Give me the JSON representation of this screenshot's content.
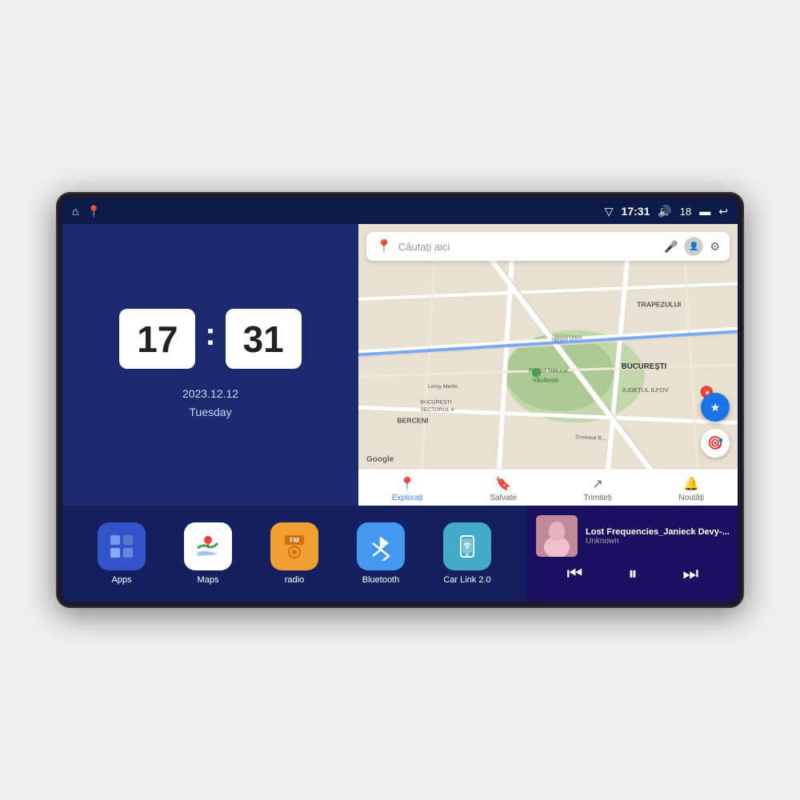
{
  "device": {
    "status_bar": {
      "left_icons": [
        "home-icon",
        "maps-icon"
      ],
      "time": "17:31",
      "volume_icon": "volume-icon",
      "volume_level": "18",
      "battery_icon": "battery-icon",
      "back_icon": "back-icon"
    }
  },
  "left_panel": {
    "clock_hour": "17",
    "clock_minute": "31",
    "date": "2023.12.12",
    "day": "Tuesday"
  },
  "map_panel": {
    "search_placeholder": "Căutați aici",
    "nav_items": [
      {
        "label": "Explorați",
        "icon": "📍",
        "active": true
      },
      {
        "label": "Salvate",
        "icon": "🔖",
        "active": false
      },
      {
        "label": "Trimiteți",
        "icon": "↗",
        "active": false
      },
      {
        "label": "Noutăți",
        "icon": "🔔",
        "active": false
      }
    ],
    "map_labels": [
      "TRAPEZULUI",
      "BUCUREȘTI",
      "JUDEȚUL ILFOV",
      "BERCENI",
      "Parcul Natural Văcărești",
      "Leroy Merlin",
      "BUCUREȘTI\nSECTORUL 4"
    ]
  },
  "apps": [
    {
      "label": "Apps",
      "icon_type": "apps",
      "emoji": "⊞"
    },
    {
      "label": "Maps",
      "icon_type": "maps",
      "emoji": "📍"
    },
    {
      "label": "radio",
      "icon_type": "radio",
      "emoji": "📻"
    },
    {
      "label": "Bluetooth",
      "icon_type": "bluetooth",
      "emoji": "⬡"
    },
    {
      "label": "Car Link 2.0",
      "icon_type": "carlink",
      "emoji": "📱"
    }
  ],
  "music": {
    "title": "Lost Frequencies_Janieck Devy-...",
    "artist": "Unknown",
    "prev_label": "⏮",
    "play_label": "⏸",
    "next_label": "⏭"
  }
}
